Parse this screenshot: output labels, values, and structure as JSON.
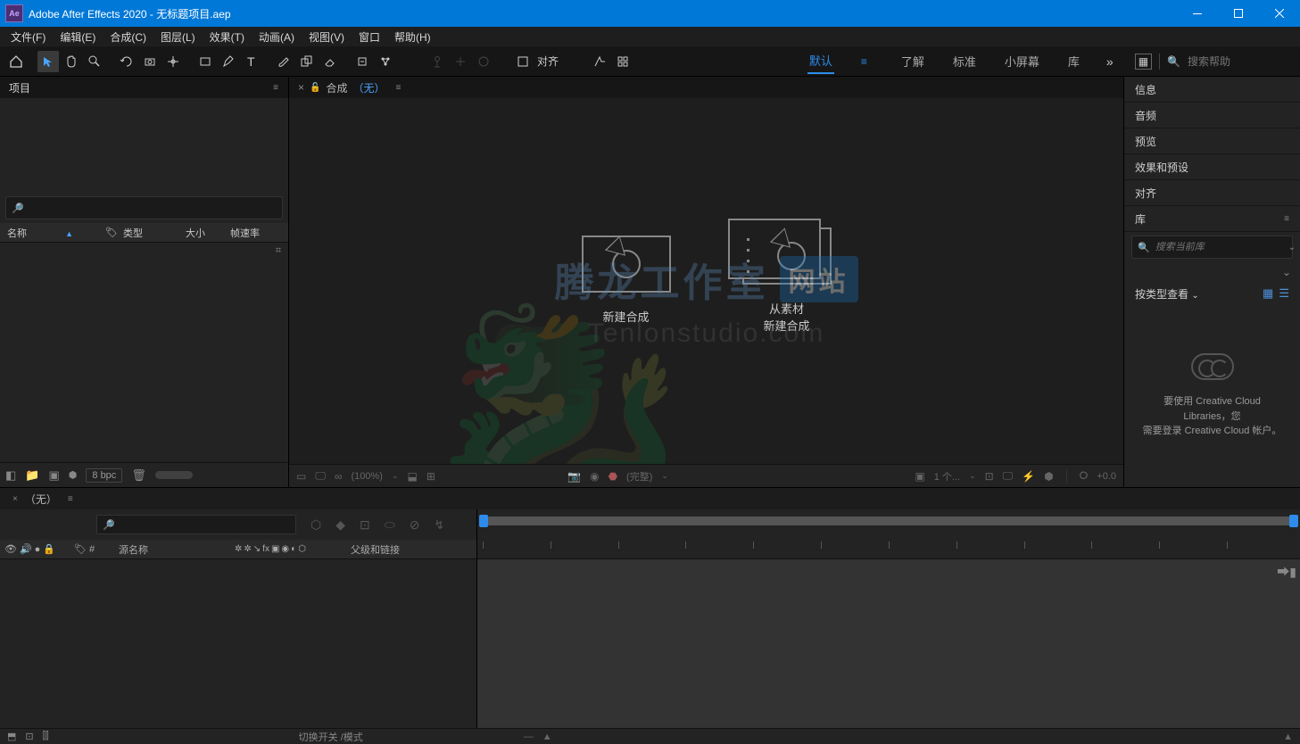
{
  "titlebar": {
    "app_badge": "Ae",
    "title": "Adobe After Effects 2020 - 无标题项目.aep"
  },
  "menubar": [
    "文件(F)",
    "编辑(E)",
    "合成(C)",
    "图层(L)",
    "效果(T)",
    "动画(A)",
    "视图(V)",
    "窗口",
    "帮助(H)"
  ],
  "toolbar": {
    "align_label": "对齐"
  },
  "workspaces": {
    "items": [
      "默认",
      "了解",
      "标准",
      "小屏幕",
      "库"
    ],
    "active_index": 0
  },
  "search": {
    "placeholder": "搜索帮助"
  },
  "project_panel": {
    "tab": "项目",
    "columns": {
      "name": "名称",
      "type": "类型",
      "size": "大小",
      "fps": "帧速率"
    },
    "bpc": "8 bpc"
  },
  "comp_panel": {
    "tab_prefix": "合成",
    "tab_none": "（无）",
    "new_comp": "新建合成",
    "from_footage_l1": "从素材",
    "from_footage_l2": "新建合成",
    "footer": {
      "zoom": "(100%)",
      "full": "(完整)",
      "view": "1 个...",
      "exposure": "+0.0"
    }
  },
  "right_panels": {
    "info": "信息",
    "audio": "音频",
    "preview": "预览",
    "effects": "效果和预设",
    "align": "对齐",
    "library": "库",
    "lib_search_placeholder": "搜索当前库",
    "view_by_type": "按类型查看",
    "cc_msg_l1": "要使用 Creative Cloud Libraries，您",
    "cc_msg_l2": "需要登录 Creative Cloud 帐户。"
  },
  "timeline": {
    "tab": "（无）",
    "source_name": "源名称",
    "parent_link": "父级和链接",
    "switches": "切换开关 /模式"
  },
  "watermark": {
    "main": "腾龙工作室",
    "badge": "网站",
    "sub": "Tenlonstudio.com"
  }
}
